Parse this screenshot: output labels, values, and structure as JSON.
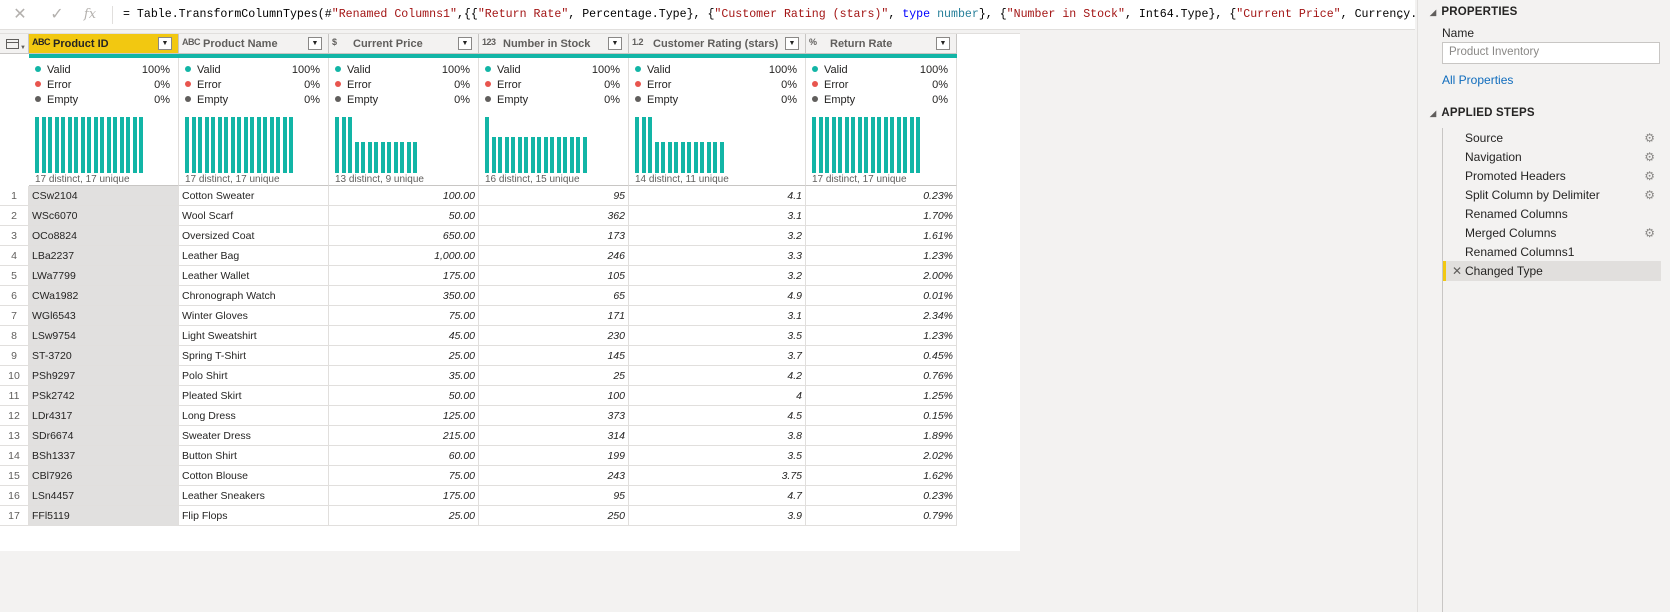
{
  "formula_bar": {
    "cancel_icon": "close-icon",
    "commit_icon": "check-icon",
    "fx_label": "fx",
    "formula": "= Table.TransformColumnTypes(#\"Renamed Columns1\",{{\"Return Rate\", Percentage.Type}, {\"Customer Rating (stars)\", type number}, {\"Number in Stock\", Int64.Type}, {\"Current Price\", Currency.Type}",
    "parts": [
      {
        "t": "= Table.TransformColumnTypes(#",
        "c": ""
      },
      {
        "t": "\"Renamed Columns1\"",
        "c": "str"
      },
      {
        "t": ",{{",
        "c": ""
      },
      {
        "t": "\"Return Rate\"",
        "c": "str"
      },
      {
        "t": ", Percentage.Type}, {",
        "c": ""
      },
      {
        "t": "\"Customer Rating (stars)\"",
        "c": "str"
      },
      {
        "t": ", ",
        "c": ""
      },
      {
        "t": "type",
        "c": "kw"
      },
      {
        "t": " ",
        "c": ""
      },
      {
        "t": "number",
        "c": "ty"
      },
      {
        "t": "}, {",
        "c": ""
      },
      {
        "t": "\"Number in Stock\"",
        "c": "str"
      },
      {
        "t": ", Int64.Type}, {",
        "c": ""
      },
      {
        "t": "\"Current Price\"",
        "c": "str"
      },
      {
        "t": ", Currency.Type}",
        "c": ""
      }
    ]
  },
  "columns": [
    {
      "type_icon": "ABC",
      "name": "Product ID",
      "valid": "100%",
      "error": "0%",
      "empty": "0%",
      "summary": "17 distinct, 17 unique",
      "hist": [
        1,
        1,
        1,
        1,
        1,
        1,
        1,
        1,
        1,
        1,
        1,
        1,
        1,
        1,
        1,
        1,
        1
      ]
    },
    {
      "type_icon": "ABC",
      "name": "Product Name",
      "valid": "100%",
      "error": "0%",
      "empty": "0%",
      "summary": "17 distinct, 17 unique",
      "hist": [
        1,
        1,
        1,
        1,
        1,
        1,
        1,
        1,
        1,
        1,
        1,
        1,
        1,
        1,
        1,
        1,
        1
      ]
    },
    {
      "type_icon": "$",
      "name": "Current Price",
      "valid": "100%",
      "error": "0%",
      "empty": "0%",
      "summary": "13 distinct, 9 unique",
      "hist": [
        1,
        1,
        1,
        0.55,
        0.55,
        0.55,
        0.55,
        0.55,
        0.55,
        0.55,
        0.55,
        0.55,
        0.55
      ]
    },
    {
      "type_icon": "123",
      "name": "Number in Stock",
      "valid": "100%",
      "error": "0%",
      "empty": "0%",
      "summary": "16 distinct, 15 unique",
      "hist": [
        1,
        0.65,
        0.65,
        0.65,
        0.65,
        0.65,
        0.65,
        0.65,
        0.65,
        0.65,
        0.65,
        0.65,
        0.65,
        0.65,
        0.65,
        0.65
      ]
    },
    {
      "type_icon": "1.2",
      "name": "Customer Rating (stars)",
      "valid": "100%",
      "error": "0%",
      "empty": "0%",
      "summary": "14 distinct, 11 unique",
      "hist": [
        1,
        1,
        1,
        0.55,
        0.55,
        0.55,
        0.55,
        0.55,
        0.55,
        0.55,
        0.55,
        0.55,
        0.55,
        0.55
      ]
    },
    {
      "type_icon": "%",
      "name": "Return Rate",
      "valid": "100%",
      "error": "0%",
      "empty": "0%",
      "summary": "17 distinct, 17 unique",
      "hist": [
        1,
        1,
        1,
        1,
        1,
        1,
        1,
        1,
        1,
        1,
        1,
        1,
        1,
        1,
        1,
        1,
        1
      ]
    }
  ],
  "labels": {
    "valid": "Valid",
    "error": "Error",
    "empty": "Empty"
  },
  "colors": {
    "valid": "#12b5a6",
    "error": "#e8554e",
    "empty": "#605e5c",
    "key_header": "#f2c811"
  },
  "rows": [
    [
      "CSw2104",
      "Cotton Sweater",
      "100.00",
      "95",
      "4.1",
      "0.23%"
    ],
    [
      "WSc6070",
      "Wool Scarf",
      "50.00",
      "362",
      "3.1",
      "1.70%"
    ],
    [
      "OCo8824",
      "Oversized Coat",
      "650.00",
      "173",
      "3.2",
      "1.61%"
    ],
    [
      "LBa2237",
      "Leather Bag",
      "1,000.00",
      "246",
      "3.3",
      "1.23%"
    ],
    [
      "LWa7799",
      "Leather Wallet",
      "175.00",
      "105",
      "3.2",
      "2.00%"
    ],
    [
      "CWa1982",
      "Chronograph Watch",
      "350.00",
      "65",
      "4.9",
      "0.01%"
    ],
    [
      "WGl6543",
      "Winter Gloves",
      "75.00",
      "171",
      "3.1",
      "2.34%"
    ],
    [
      "LSw9754",
      "Light Sweatshirt",
      "45.00",
      "230",
      "3.5",
      "1.23%"
    ],
    [
      "ST-3720",
      "Spring T-Shirt",
      "25.00",
      "145",
      "3.7",
      "0.45%"
    ],
    [
      "PSh9297",
      "Polo Shirt",
      "35.00",
      "25",
      "4.2",
      "0.76%"
    ],
    [
      "PSk2742",
      "Pleated Skirt",
      "50.00",
      "100",
      "4",
      "1.25%"
    ],
    [
      "LDr4317",
      "Long Dress",
      "125.00",
      "373",
      "4.5",
      "0.15%"
    ],
    [
      "SDr6674",
      "Sweater Dress",
      "215.00",
      "314",
      "3.8",
      "1.89%"
    ],
    [
      "BSh1337",
      "Button Shirt",
      "60.00",
      "199",
      "3.5",
      "2.02%"
    ],
    [
      "CBl7926",
      "Cotton Blouse",
      "75.00",
      "243",
      "3.75",
      "1.62%"
    ],
    [
      "LSn4457",
      "Leather Sneakers",
      "175.00",
      "95",
      "4.7",
      "0.23%"
    ],
    [
      "FFl5119",
      "Flip Flops",
      "25.00",
      "250",
      "3.9",
      "0.79%"
    ]
  ],
  "properties": {
    "title": "PROPERTIES",
    "name_label": "Name",
    "name_value": "Product Inventory",
    "all_properties": "All Properties"
  },
  "applied_steps": {
    "title": "APPLIED STEPS",
    "steps": [
      {
        "label": "Source",
        "gear": true
      },
      {
        "label": "Navigation",
        "gear": true
      },
      {
        "label": "Promoted Headers",
        "gear": true
      },
      {
        "label": "Split Column by Delimiter",
        "gear": true
      },
      {
        "label": "Renamed Columns",
        "gear": false
      },
      {
        "label": "Merged Columns",
        "gear": true
      },
      {
        "label": "Renamed Columns1",
        "gear": false
      },
      {
        "label": "Changed Type",
        "gear": false,
        "active": true
      }
    ]
  }
}
